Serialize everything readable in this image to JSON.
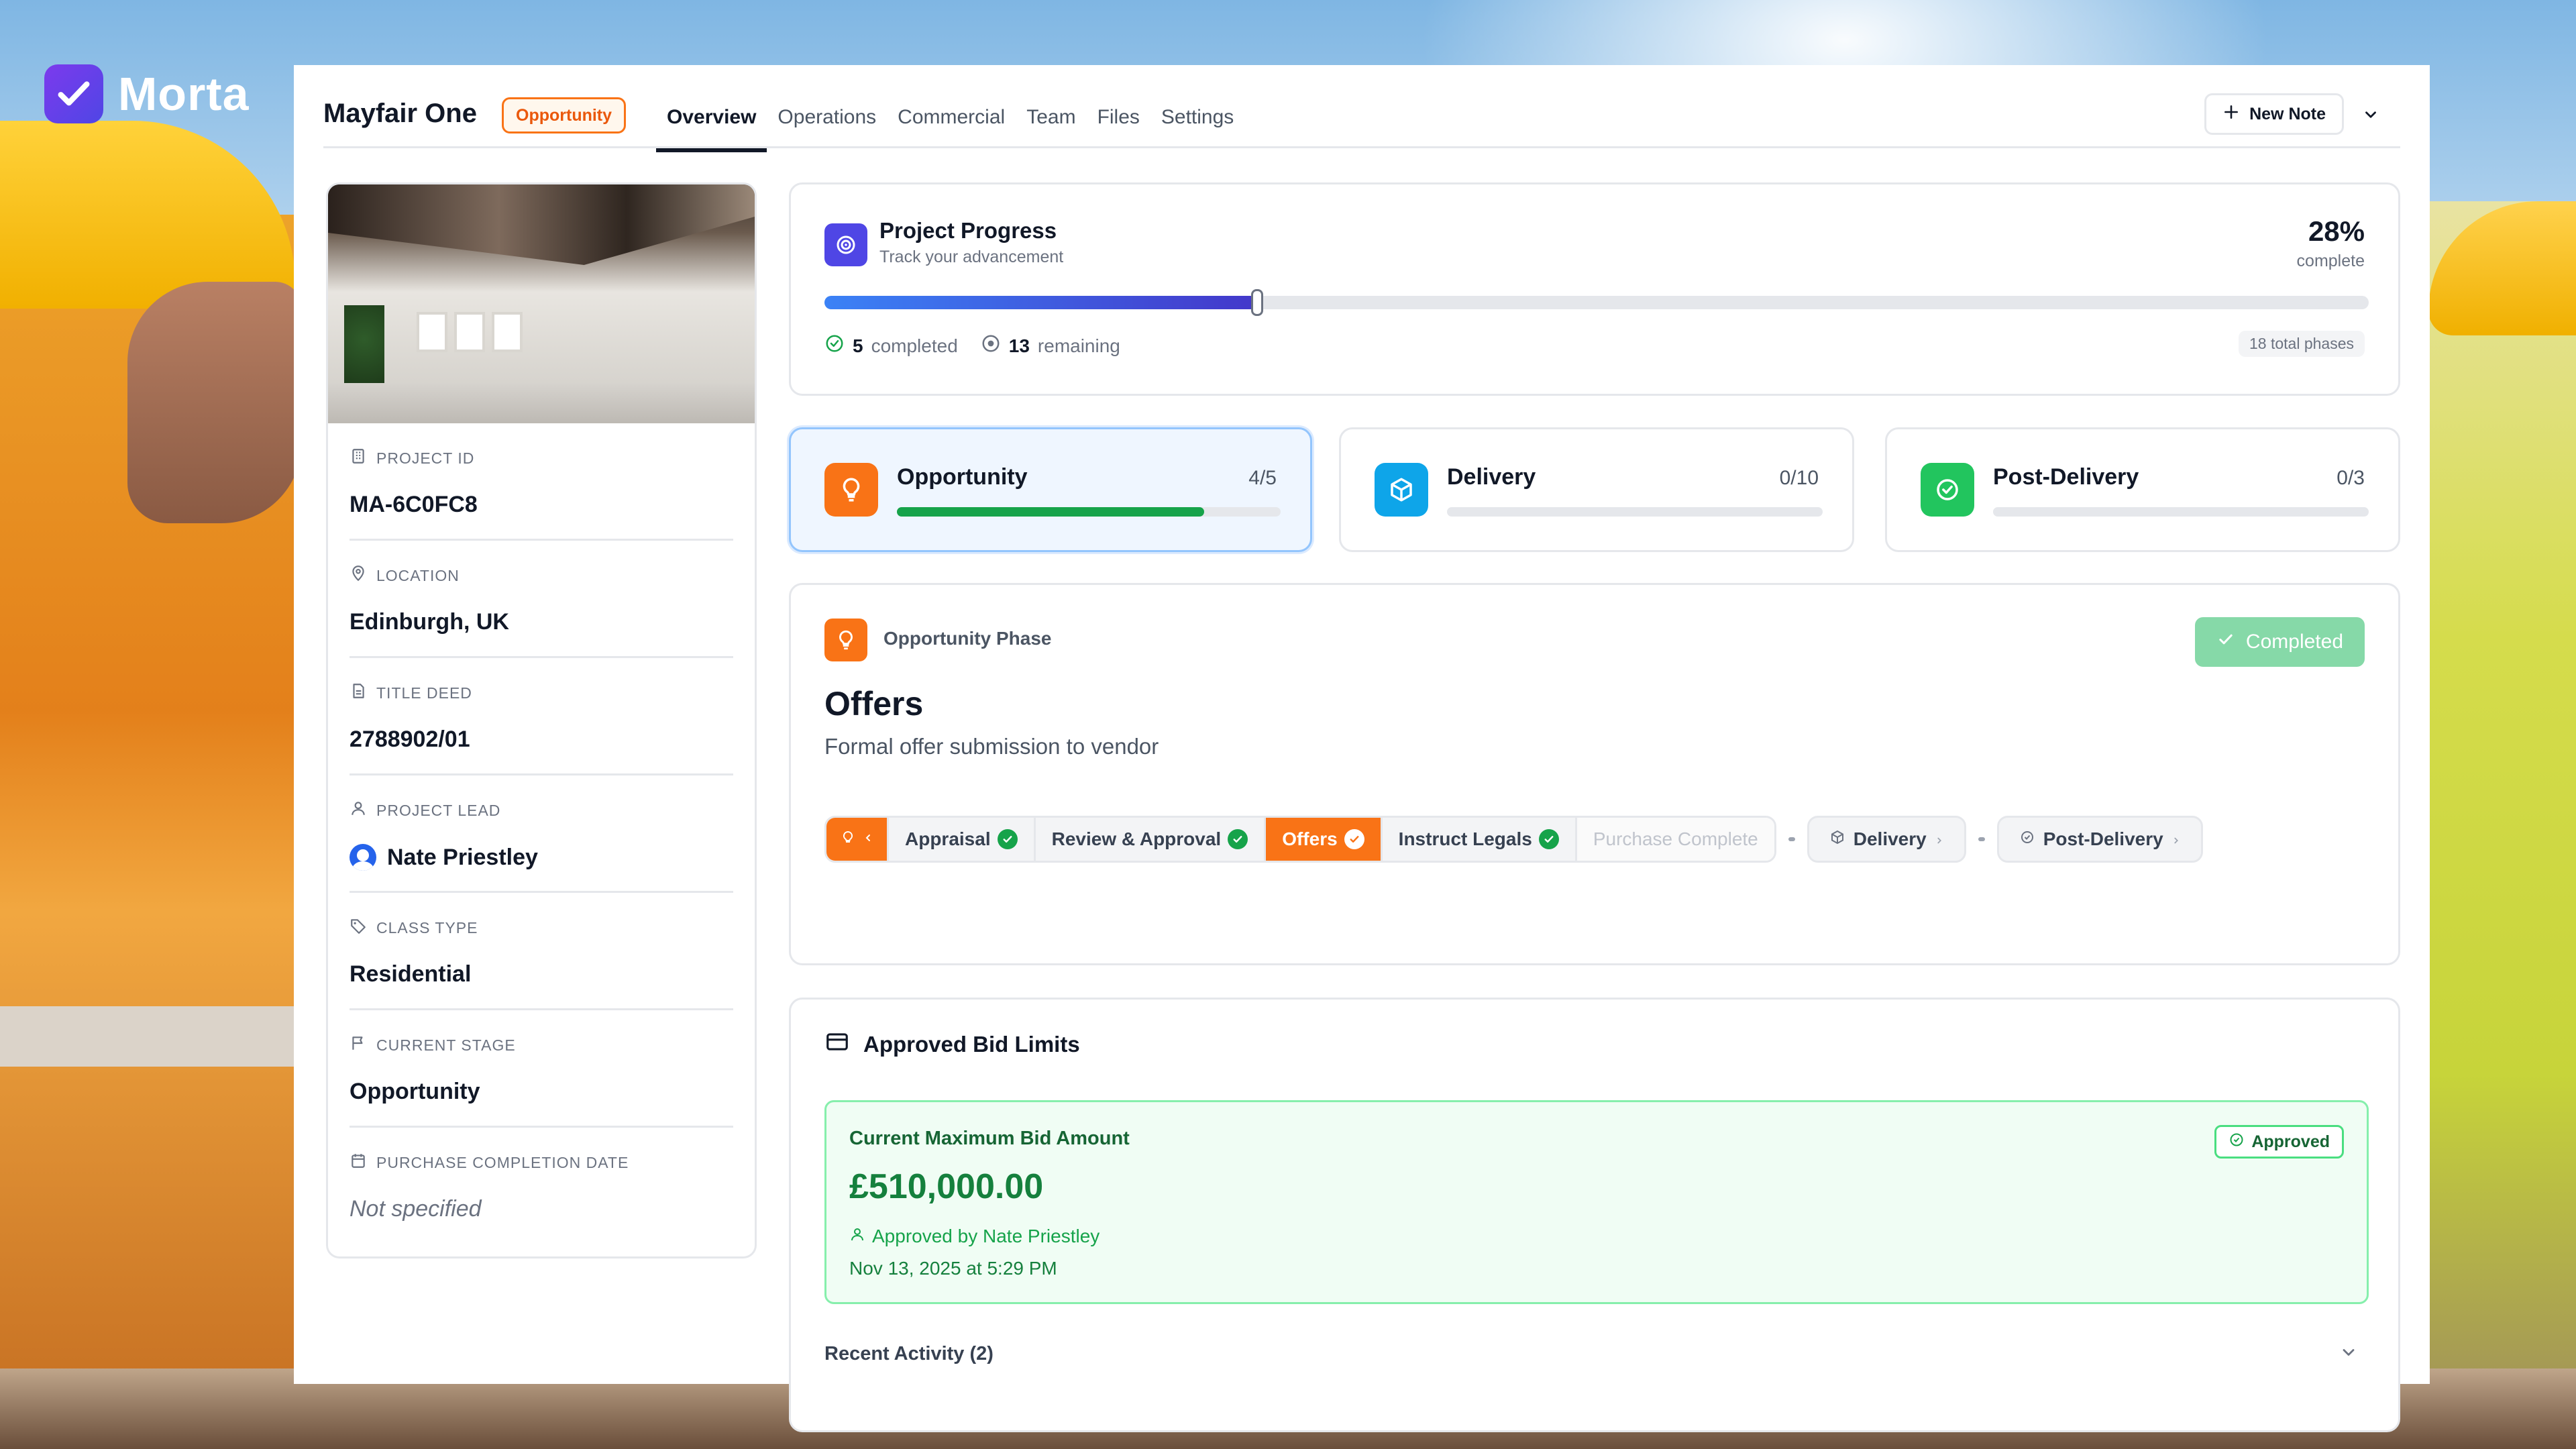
{
  "brand": {
    "name": "Morta"
  },
  "header": {
    "project_name": "Mayfair One",
    "status_badge": "Opportunity",
    "tabs": [
      {
        "label": "Overview",
        "active": true
      },
      {
        "label": "Operations",
        "active": false
      },
      {
        "label": "Commercial",
        "active": false
      },
      {
        "label": "Team",
        "active": false
      },
      {
        "label": "Files",
        "active": false
      },
      {
        "label": "Settings",
        "active": false
      }
    ],
    "new_note_label": "New Note"
  },
  "info": {
    "project_id": {
      "label": "PROJECT ID",
      "value": "MA-6C0FC8"
    },
    "location": {
      "label": "LOCATION",
      "value": "Edinburgh, UK"
    },
    "title_deed": {
      "label": "TITLE DEED",
      "value": "2788902/01"
    },
    "project_lead": {
      "label": "PROJECT LEAD",
      "value": "Nate Priestley"
    },
    "class_type": {
      "label": "CLASS TYPE",
      "value": "Residential"
    },
    "current_stage": {
      "label": "CURRENT STAGE",
      "value": "Opportunity"
    },
    "purchase_completion_date": {
      "label": "PURCHASE COMPLETION DATE",
      "value": "Not specified"
    }
  },
  "progress": {
    "title": "Project Progress",
    "subtitle": "Track your advancement",
    "percent_label": "28%",
    "percent_value": 28,
    "complete_label": "complete",
    "completed_count": "5",
    "completed_label": "completed",
    "remaining_count": "13",
    "remaining_label": "remaining",
    "total_phases": "18 total phases"
  },
  "phases": [
    {
      "name": "Opportunity",
      "count": "4/5",
      "fill": 0.8,
      "color": "#f97316",
      "active": true
    },
    {
      "name": "Delivery",
      "count": "0/10",
      "fill": 0,
      "color": "#0ea5e9",
      "active": false
    },
    {
      "name": "Post-Delivery",
      "count": "0/3",
      "fill": 0,
      "color": "#22c55e",
      "active": false
    }
  ],
  "phase_detail": {
    "phase_label": "Opportunity Phase",
    "completed_label": "Completed",
    "title": "Offers",
    "description": "Formal offer submission to vendor",
    "steps": [
      {
        "label": "Appraisal",
        "state": "done"
      },
      {
        "label": "Review & Approval",
        "state": "done"
      },
      {
        "label": "Offers",
        "state": "current"
      },
      {
        "label": "Instruct Legals",
        "state": "done"
      },
      {
        "label": "Purchase Complete",
        "state": "future"
      }
    ],
    "next_phases": [
      {
        "label": "Delivery"
      },
      {
        "label": "Post-Delivery"
      }
    ]
  },
  "bid": {
    "section_title": "Approved Bid Limits",
    "label": "Current Maximum Bid Amount",
    "status": "Approved",
    "amount": "£510,000.00",
    "approved_by": "Approved by Nate Priestley",
    "date": "Nov 13, 2025 at 5:29 PM",
    "recent_activity": "Recent Activity (2)"
  },
  "colors": {
    "accent": "#4f46e5",
    "orange": "#f97316",
    "green": "#16a34a",
    "blue": "#3b82f6"
  }
}
